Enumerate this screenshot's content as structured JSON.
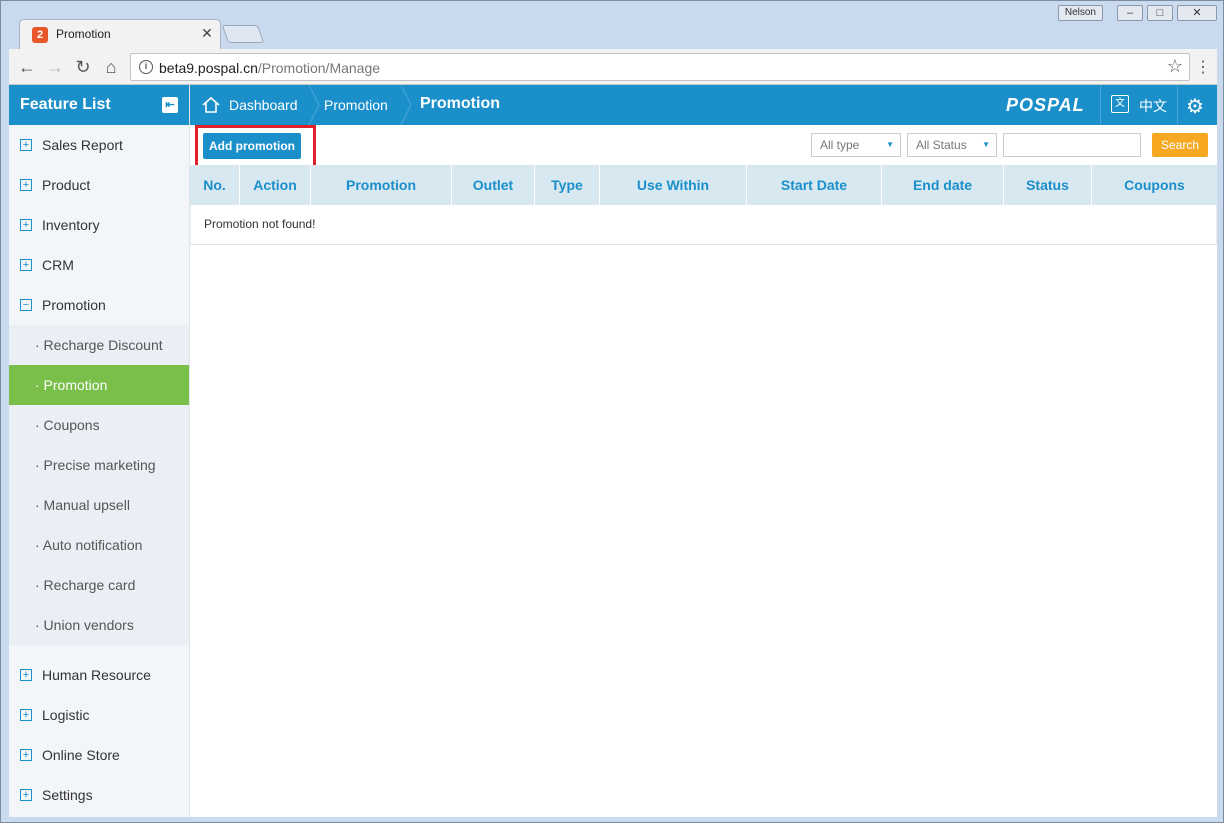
{
  "browser": {
    "tab_title": "Promotion",
    "url_host": "beta9.pospal.cn",
    "url_path": "/Promotion/Manage",
    "user": "Nelson"
  },
  "sidebar": {
    "title": "Feature List",
    "items_top": [
      {
        "label": "Sales Report"
      },
      {
        "label": "Product"
      },
      {
        "label": "Inventory"
      },
      {
        "label": "CRM"
      },
      {
        "label": "Promotion"
      }
    ],
    "submenu": [
      {
        "label": "· Recharge Discount"
      },
      {
        "label": "· Promotion"
      },
      {
        "label": "· Coupons"
      },
      {
        "label": "· Precise marketing"
      },
      {
        "label": "· Manual upsell"
      },
      {
        "label": "· Auto notification"
      },
      {
        "label": "· Recharge card"
      },
      {
        "label": "· Union vendors"
      }
    ],
    "items_bottom": [
      {
        "label": "Human Resource"
      },
      {
        "label": "Logistic"
      },
      {
        "label": "Online Store"
      },
      {
        "label": "Settings"
      }
    ]
  },
  "header": {
    "crumb_dashboard": "Dashboard",
    "crumb_section": "Promotion",
    "crumb_current": "Promotion",
    "brand": "POSPAL",
    "lang_label": "中文",
    "lang_icon": "文"
  },
  "filters": {
    "add_label": "Add promotion",
    "type": "All type",
    "status": "All Status",
    "search_value": "",
    "search_label": "Search"
  },
  "table": {
    "columns": [
      "No.",
      "Action",
      "Promotion",
      "Outlet",
      "Type",
      "Use Within",
      "Start Date",
      "End date",
      "Status",
      "Coupons"
    ],
    "empty_message": "Promotion not found!"
  },
  "colors": {
    "accent": "#1b8fca",
    "active_menu": "#79bf49",
    "search_button": "#f7a823",
    "highlight_box": "#e0202a"
  }
}
